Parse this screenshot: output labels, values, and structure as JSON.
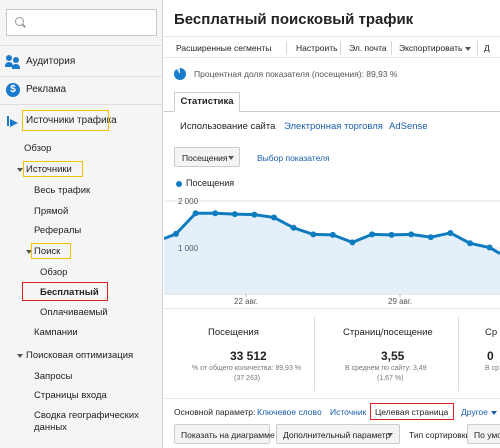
{
  "sidebar": {
    "search_placeholder": "",
    "sections": {
      "audience": "Аудитория",
      "ads": "Реклама",
      "ads_symbol": "$",
      "traffic": "Источники трафика"
    },
    "items": {
      "overview": "Обзор",
      "sources": "Источники",
      "all_traffic": "Весь трафик",
      "direct": "Прямой",
      "referrals": "Рефералы",
      "search": "Поиск",
      "search_overview": "Обзор",
      "organic": "Бесплатный",
      "paid": "Оплачиваемый",
      "campaigns": "Кампании",
      "seo": "Поисковая оптимизация",
      "queries": "Запросы",
      "landing_pages": "Страницы входа",
      "geo_summary_line1": "Сводка географических",
      "geo_summary_line2": "данных"
    }
  },
  "main": {
    "title": "Бесплатный поисковый трафик",
    "toolbar": {
      "advanced_segments": "Расширенные сегменты",
      "customize": "Настроить",
      "email": "Эл. почта",
      "export": "Экспортировать",
      "dashboard_clip": "Д"
    },
    "sampling_text": "Процентная доля показателя (посещения): 89,93 %",
    "tab": "Статистика",
    "subtabs": {
      "site_usage": "Использование сайта",
      "ecommerce": "Электронная торговля",
      "adsense": "AdSense"
    },
    "metric_select": "Посещения",
    "choose_metric": "Выбор показателя",
    "legend": "Посещения",
    "dimensions": {
      "label": "Основной параметр:",
      "keyword": "Ключевое слово",
      "source": "Источник",
      "landing_page": "Целевая страница",
      "other": "Другое"
    },
    "bottom": {
      "plot_rows": "Показать на диаграмме",
      "secondary_dimension": "Дополнительный параметр",
      "sort_type": "Тип сортировки:",
      "sort_value": "По умолч"
    },
    "scorecards": [
      {
        "title": "Посещения",
        "value": "33 512",
        "sub1": "% от общего количества: 89,93 %",
        "sub2": "(37 263)"
      },
      {
        "title": "Страниц/посещение",
        "value": "3,55",
        "sub1": "В среднем по сайту: 3,49",
        "sub2": "(1,67 %)"
      },
      {
        "title": "Ср",
        "value": "0",
        "sub1": "В ср",
        "sub2": ""
      }
    ]
  },
  "colors": {
    "accent": "#1a7acb",
    "line": "#0f7cc0",
    "area_fill": "#e3f0fa",
    "link": "#1a5ea8",
    "highlight_yellow": "#f2c200",
    "highlight_red": "#e02020"
  },
  "chart_data": {
    "type": "area",
    "series": [
      {
        "name": "Посещения",
        "values": [
          1300,
          1740,
          1740,
          1720,
          1710,
          1650,
          1430,
          1290,
          1280,
          1120,
          1290,
          1280,
          1290,
          1230,
          1320,
          1100,
          1010
        ]
      }
    ],
    "y_ticks": [
      "2 000",
      "1 000"
    ],
    "x_ticks": [
      "22 авг.",
      "29 авг."
    ],
    "ylim": [
      0,
      2000
    ],
    "grid": true
  }
}
